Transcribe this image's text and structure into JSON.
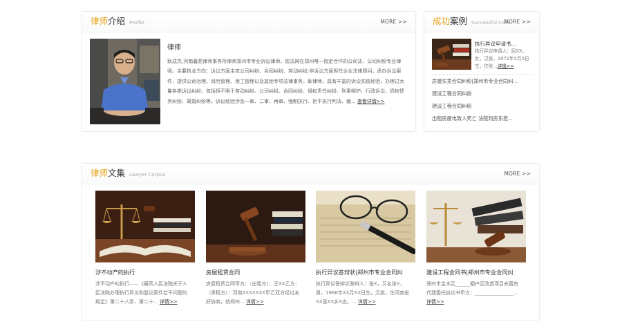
{
  "profile": {
    "title_accent": "律师",
    "title_rest": "介绍",
    "title_en": "Profile",
    "more": "MORE >>",
    "name": "律师",
    "text": "耿成杰,河南鑫苑律师事务所律师郑州市专业诉讼律师，现法网在郑州唯一指定合作的公司法、公司纠纷专业律师。主要执业方向：诉讼方面主攻公司纠纷、合同纠纷、劳动纠纷;非诉讼方面担任企业法律顾问，承办诉讼案件，提供公司治理、风险管理、用工管理以及其他专项法律事务。耿律师，具有丰富的诉讼实践经验，办理过大量各类诉讼纠纷，包括但不限于劳动纠纷、公司纠纷、合同纠纷、侵权责任纠纷、刑事辩护、行政诉讼、债权债务纠纷、离婚纠纷等，诉讼经验涉及一审、二审、再审、强制执行、拒不执行判决、裁... ",
    "detail_link": "查看详情>>"
  },
  "cases": {
    "title_accent": "成功",
    "title_rest": "案例",
    "title_en": "Successful Case",
    "more": "MORE >>",
    "featured_title": "执行异议申请书...",
    "featured_desc": "执行异议申请人：屈XX，女，汉族，1972年X月X日生，住登...",
    "featured_link": "详情>>",
    "items": [
      "房屋买卖合同纠纷|郑州市专业合同纠...",
      "建设工程合同纠纷",
      "建设工程合同纠纷",
      "出租房屋电致人死亡 法院判房东担..."
    ]
  },
  "corpus": {
    "title_accent": "律师",
    "title_rest": "文集",
    "title_en": "Lawyer Corpus",
    "more": "MORE >>",
    "articles": [
      {
        "title": "涉不动产的执行",
        "text": "涉不动产的执行——《最高人民法院关于人民法院办理执行异议和复议案件若干问题的规定》第二十八条、第二十... ",
        "link": "详情>>"
      },
      {
        "title": "房屋租赁合同",
        "text": "房屋租赁合同甲方：（出租方）：王XX乙方：（承租方）：河南XXXXXXX甲乙双方经过友好协商，就郑州... ",
        "link": "详情>>"
      },
      {
        "title": "执行异议答辩状|郑州市专业合同纠",
        "text": "执行异议答辩状答辩人：张X，又名张X，男，1966年XX月XX日生，汉族，住河南省XX县XX乡X庄。... ",
        "link": "详情>>"
      },
      {
        "title": "建设工程合同书|郑州市专业合同纠",
        "text": "郑州市金水区______棚户区改造项目安置房代建委托协议书甲方：________________... ",
        "link": "详情>>"
      }
    ]
  }
}
